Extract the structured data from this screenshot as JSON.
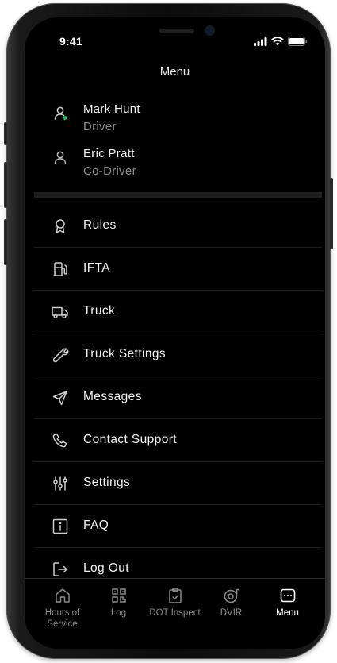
{
  "status_bar": {
    "time": "9:41"
  },
  "header": {
    "title": "Menu"
  },
  "users": [
    {
      "name": "Mark Hunt",
      "role": "Driver",
      "online_color": "#22c55e"
    },
    {
      "name": "Eric Pratt",
      "role": "Co-Driver"
    }
  ],
  "menu": {
    "items": [
      {
        "label": "Rules",
        "icon": "award-icon"
      },
      {
        "label": "IFTA",
        "icon": "fuel-pump-icon"
      },
      {
        "label": "Truck",
        "icon": "truck-icon"
      },
      {
        "label": "Truck Settings",
        "icon": "wrench-icon"
      },
      {
        "label": "Messages",
        "icon": "send-icon"
      },
      {
        "label": "Contact Support",
        "icon": "phone-icon"
      },
      {
        "label": "Settings",
        "icon": "sliders-icon"
      },
      {
        "label": "FAQ",
        "icon": "info-icon"
      },
      {
        "label": "Log Out",
        "icon": "logout-icon"
      }
    ]
  },
  "tabs": [
    {
      "label": "Hours of Service",
      "icon": "home-icon",
      "active": false
    },
    {
      "label": "Log",
      "icon": "qr-code-icon",
      "active": false
    },
    {
      "label": "DOT Inspect",
      "icon": "clipboard-check-icon",
      "active": false
    },
    {
      "label": "DVIR",
      "icon": "tire-icon",
      "active": false
    },
    {
      "label": "Menu",
      "icon": "menu-dots-icon",
      "active": true
    }
  ],
  "colors": {
    "background": "#000000",
    "text": "#f2f2f2",
    "muted_text": "#8d8d8d",
    "divider": "#1d1d1d",
    "online": "#22c55e"
  }
}
